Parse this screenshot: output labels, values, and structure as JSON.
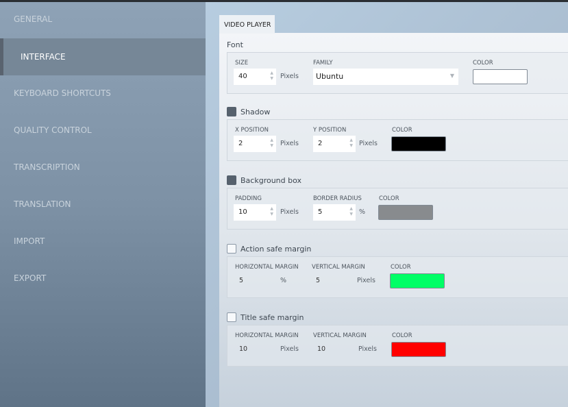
{
  "sidebar": {
    "items": [
      {
        "label": "GENERAL",
        "active": false
      },
      {
        "label": "INTERFACE",
        "active": true
      },
      {
        "label": "KEYBOARD SHORTCUTS",
        "active": false
      },
      {
        "label": "QUALITY CONTROL",
        "active": false
      },
      {
        "label": "TRANSCRIPTION",
        "active": false
      },
      {
        "label": "TRANSLATION",
        "active": false
      },
      {
        "label": "IMPORT",
        "active": false
      },
      {
        "label": "EXPORT",
        "active": false
      }
    ]
  },
  "tab": "VIDEO PLAYER",
  "font": {
    "title": "Font",
    "size_label": "SIZE",
    "size": "40",
    "size_unit": "Pixels",
    "family_label": "FAMILY",
    "family": "Ubuntu",
    "color_label": "COLOR",
    "color": "#ffffff"
  },
  "shadow": {
    "title": "Shadow",
    "checked": true,
    "x_label": "X POSITION",
    "x": "2",
    "x_unit": "Pixels",
    "y_label": "Y POSITION",
    "y": "2",
    "y_unit": "Pixels",
    "color_label": "COLOR",
    "color": "#000000"
  },
  "background": {
    "title": "Background box",
    "checked": true,
    "padding_label": "PADDING",
    "padding": "10",
    "padding_unit": "Pixels",
    "radius_label": "BORDER RADIUS",
    "radius": "5",
    "radius_unit": "%",
    "color_label": "COLOR",
    "color": "#888b8e"
  },
  "action": {
    "title": "Action safe margin",
    "checked": false,
    "h_label": "HORIZONTAL MARGIN",
    "h": "5",
    "h_unit": "%",
    "v_label": "VERTICAL MARGIN",
    "v": "5",
    "v_unit": "Pixels",
    "color_label": "COLOR",
    "color": "#00ff66"
  },
  "title_safe": {
    "title": "Title safe margin",
    "checked": false,
    "h_label": "HORIZONTAL MARGIN",
    "h": "10",
    "h_unit": "Pixels",
    "v_label": "VERTICAL MARGIN",
    "v": "10",
    "v_unit": "Pixels",
    "color_label": "COLOR",
    "color": "#ff0000"
  }
}
